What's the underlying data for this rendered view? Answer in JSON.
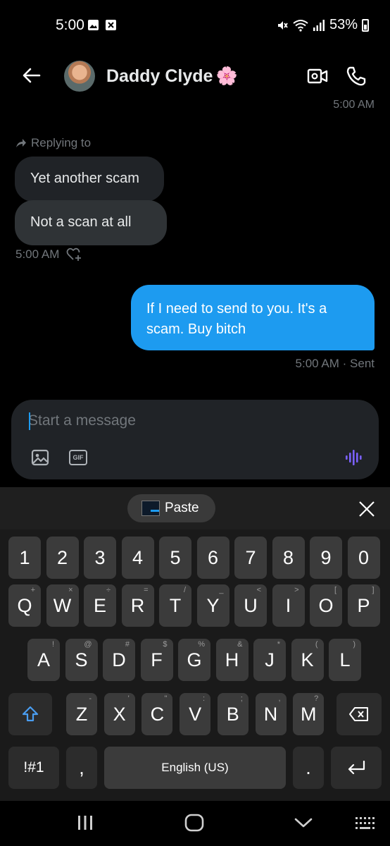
{
  "status_bar": {
    "time": "5:00",
    "battery": "53%"
  },
  "header": {
    "contact_name": "Daddy Clyde",
    "emoji": "🌸"
  },
  "conversation": {
    "top_timestamp": "5:00 AM",
    "replying_label": "Replying to",
    "quoted_message": "Yet another scam",
    "reply_message": "Not a scan at all",
    "incoming_time": "5:00 AM",
    "outgoing_message": "If I need to send to you. It's a scam. Buy bitch",
    "outgoing_meta": "5:00 AM · Sent"
  },
  "composer": {
    "placeholder": "Start a message",
    "gif_label": "GIF"
  },
  "keyboard": {
    "paste_label": "Paste",
    "number_row": [
      "1",
      "2",
      "3",
      "4",
      "5",
      "6",
      "7",
      "8",
      "9",
      "0"
    ],
    "row1": [
      {
        "k": "Q",
        "h": "+"
      },
      {
        "k": "W",
        "h": "×"
      },
      {
        "k": "E",
        "h": "÷"
      },
      {
        "k": "R",
        "h": "="
      },
      {
        "k": "T",
        "h": "/"
      },
      {
        "k": "Y",
        "h": "_"
      },
      {
        "k": "U",
        "h": "<"
      },
      {
        "k": "I",
        "h": ">"
      },
      {
        "k": "O",
        "h": "["
      },
      {
        "k": "P",
        "h": "]"
      }
    ],
    "row2": [
      {
        "k": "A",
        "h": "!"
      },
      {
        "k": "S",
        "h": "@"
      },
      {
        "k": "D",
        "h": "#"
      },
      {
        "k": "F",
        "h": "$"
      },
      {
        "k": "G",
        "h": "%"
      },
      {
        "k": "H",
        "h": "&"
      },
      {
        "k": "J",
        "h": "*"
      },
      {
        "k": "K",
        "h": "("
      },
      {
        "k": "L",
        "h": ")"
      }
    ],
    "row3": [
      {
        "k": "Z",
        "h": "-"
      },
      {
        "k": "X",
        "h": "'"
      },
      {
        "k": "C",
        "h": "\""
      },
      {
        "k": "V",
        "h": ":"
      },
      {
        "k": "B",
        "h": ";"
      },
      {
        "k": "N",
        "h": ","
      },
      {
        "k": "M",
        "h": "?"
      }
    ],
    "symbols_label": "!#1",
    "comma_label": ",",
    "space_label": "English (US)",
    "period_label": "."
  }
}
